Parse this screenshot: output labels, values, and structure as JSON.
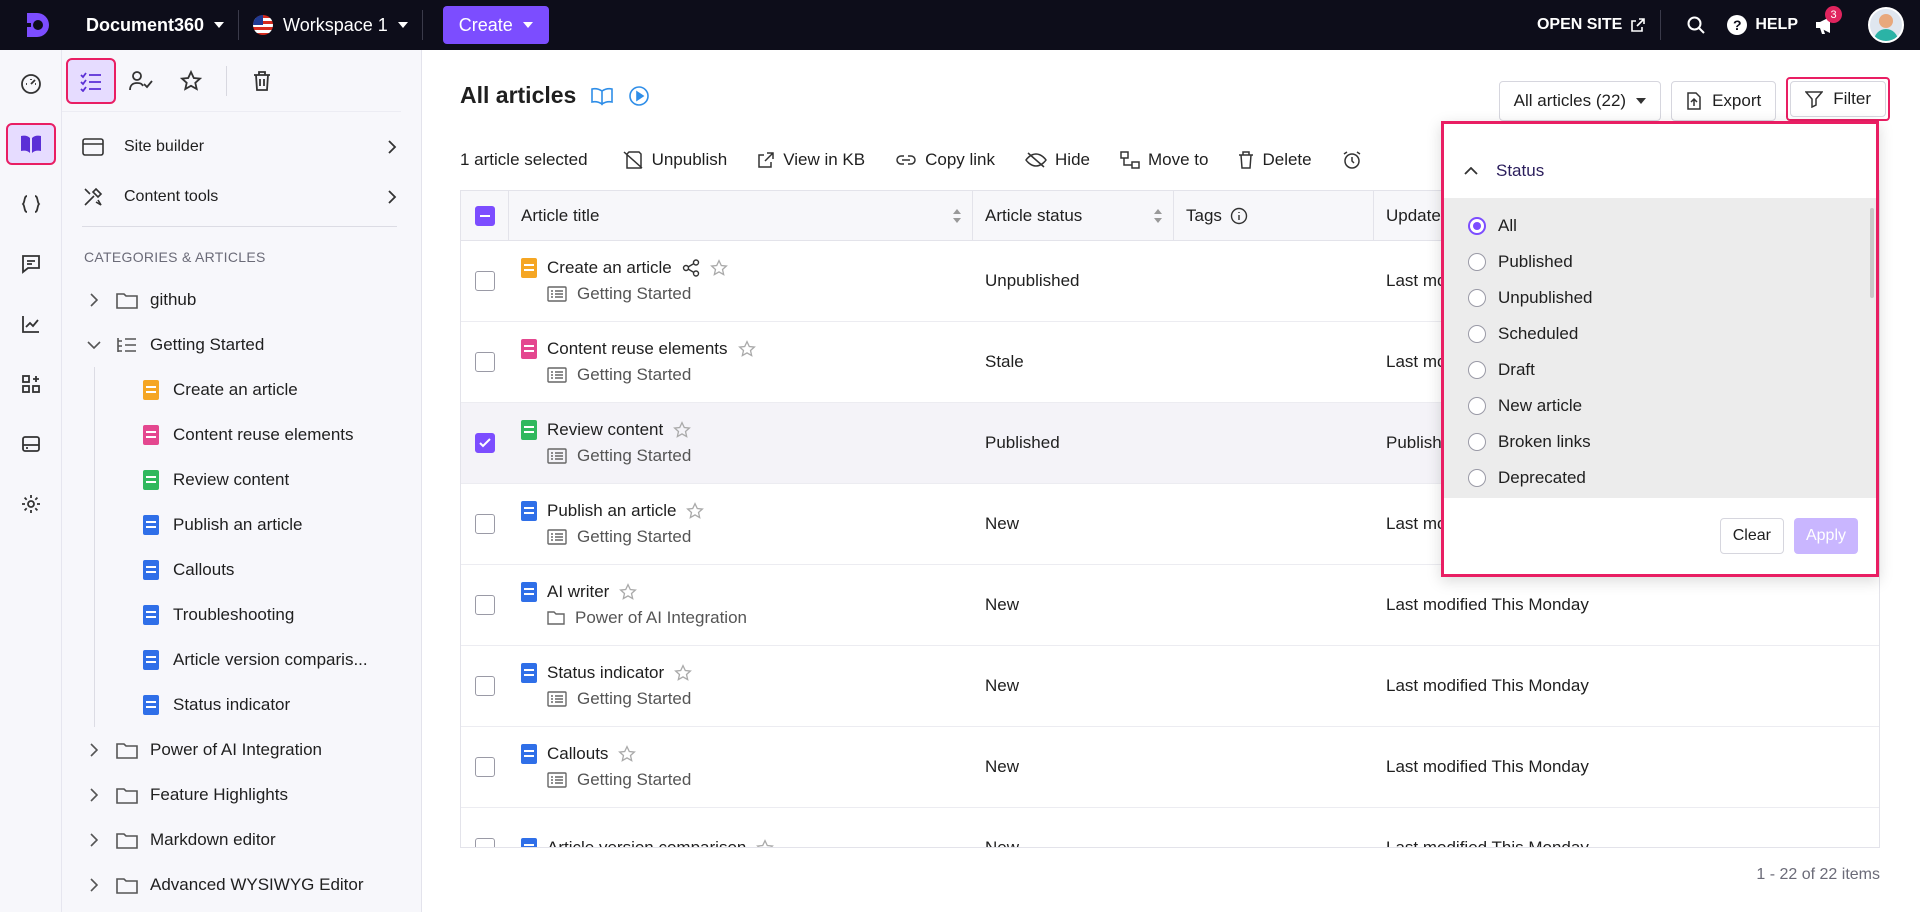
{
  "topbar": {
    "project": "Document360",
    "workspace": "Workspace 1",
    "create_label": "Create",
    "open_site": "OPEN SITE",
    "help": "HELP",
    "help_glyph": "?",
    "notification_count": "3",
    "brand_color": "#7c4dff",
    "bar_color": "#0d0d1a"
  },
  "rail": {
    "icons": [
      "dashboard-icon",
      "documentation-icon",
      "api-docs-icon",
      "feedback-icon",
      "analytics-icon",
      "widgets-icon",
      "drive-icon",
      "settings-icon"
    ],
    "active": "documentation-icon"
  },
  "sidebar": {
    "tools": [
      "all-articles-icon",
      "my-articles-icon",
      "starred-icon",
      "recycle-bin-icon"
    ],
    "links": [
      {
        "label": "Site builder"
      },
      {
        "label": "Content tools"
      }
    ],
    "heading": "CATEGORIES & ARTICLES",
    "tree": {
      "github": "github",
      "getting_started": "Getting Started",
      "children": [
        {
          "label": "Create an article",
          "color": "orange"
        },
        {
          "label": "Content reuse elements",
          "color": "pink"
        },
        {
          "label": "Review content",
          "color": "green"
        },
        {
          "label": "Publish an article",
          "color": "blue"
        },
        {
          "label": "Callouts",
          "color": "blue"
        },
        {
          "label": "Troubleshooting",
          "color": "blue"
        },
        {
          "label": "Article version comparis...",
          "color": "blue"
        },
        {
          "label": "Status indicator",
          "color": "blue"
        }
      ],
      "after": [
        {
          "label": "Power of AI Integration"
        },
        {
          "label": "Feature Highlights"
        },
        {
          "label": "Markdown editor"
        },
        {
          "label": "Advanced WYSIWYG Editor"
        }
      ]
    }
  },
  "main": {
    "title": "All articles",
    "view_dropdown": "All articles (22)",
    "export": "Export",
    "filter": "Filter",
    "selected_count": "1 article selected",
    "bulk_actions": {
      "unpublish": "Unpublish",
      "view_kb": "View in KB",
      "copy_link": "Copy link",
      "hide": "Hide",
      "move": "Move to",
      "delete": "Delete"
    },
    "columns": {
      "title": "Article title",
      "status": "Article status",
      "tags": "Tags",
      "updated": "Update"
    },
    "rows": [
      {
        "title": "Create an article",
        "category": "Getting Started",
        "status": "Unpublished",
        "updated": "Last mo",
        "color": "orange",
        "checked": false,
        "shared": true,
        "cat_type": "folder-list"
      },
      {
        "title": "Content reuse elements",
        "category": "Getting Started",
        "status": "Stale",
        "updated": "Last mo",
        "color": "pink",
        "checked": false,
        "shared": false,
        "cat_type": "folder-list"
      },
      {
        "title": "Review content",
        "category": "Getting Started",
        "status": "Published",
        "updated": "Publish",
        "color": "green",
        "checked": true,
        "shared": false,
        "cat_type": "folder-list"
      },
      {
        "title": "Publish an article",
        "category": "Getting Started",
        "status": "New",
        "updated": "Last mo",
        "color": "blue",
        "checked": false,
        "shared": false,
        "cat_type": "folder-list"
      },
      {
        "title": "AI writer",
        "category": "Power of AI Integration",
        "status": "New",
        "updated": "Last modified This Monday",
        "color": "blue",
        "checked": false,
        "shared": false,
        "cat_type": "folder"
      },
      {
        "title": "Status indicator",
        "category": "Getting Started",
        "status": "New",
        "updated": "Last modified This Monday",
        "color": "blue",
        "checked": false,
        "shared": false,
        "cat_type": "folder-list"
      },
      {
        "title": "Callouts",
        "category": "Getting Started",
        "status": "New",
        "updated": "Last modified This Monday",
        "color": "blue",
        "checked": false,
        "shared": false,
        "cat_type": "folder-list"
      },
      {
        "title": "Article version comparison",
        "category": "",
        "status": "New",
        "updated": "Last modified This Monday",
        "color": "blue",
        "checked": false,
        "shared": false,
        "cat_type": "none"
      }
    ],
    "pager": "1 - 22 of 22 items"
  },
  "filter_popup": {
    "section": "Status",
    "options": [
      "All",
      "Published",
      "Unpublished",
      "Scheduled",
      "Draft",
      "New article",
      "Broken links",
      "Deprecated"
    ],
    "selected": "All",
    "clear": "Clear",
    "apply": "Apply"
  }
}
